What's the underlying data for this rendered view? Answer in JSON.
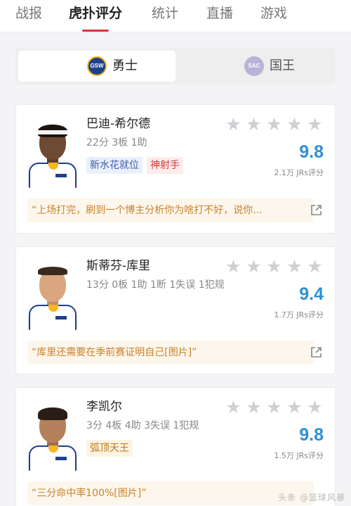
{
  "top_tabs": [
    {
      "label": "战报"
    },
    {
      "label": "虎扑评分"
    },
    {
      "label": "统计"
    },
    {
      "label": "直播"
    },
    {
      "label": "游戏"
    }
  ],
  "team_switch": {
    "home": {
      "logo_text": "GSW",
      "name": "勇士",
      "icon": "warriors-logo-icon"
    },
    "away": {
      "logo_text": "SAC",
      "name": "国王",
      "icon": "kings-logo-icon"
    }
  },
  "colors": {
    "accent_red": "#d33a3a",
    "score_blue": "#2e8fd4",
    "comment_gold": "#c9822c",
    "star_gray": "#cfcfd4"
  },
  "players": [
    {
      "name": "巴迪-希尔德",
      "stats": "22分 3板 1助",
      "tags": [
        {
          "text": "新水花就位",
          "style": "blue"
        },
        {
          "text": "神射手",
          "style": "red"
        }
      ],
      "stars_filled": 0,
      "score": "9.8",
      "raters": "2.1万 JRs评分",
      "comment": "“上场打完，刷到一个博主分析你为啥打不好，说你..."
    },
    {
      "name": "斯蒂芬-库里",
      "stats": "13分 0板 1助 1断 1失误 1犯规",
      "tags": [],
      "stars_filled": 0,
      "score": "9.4",
      "raters": "1.7万 JRs评分",
      "comment": "“库里还需要在季前赛证明自己[图片]”"
    },
    {
      "name": "李凯尔",
      "stats": "3分 4板 4助 3失误 1犯规",
      "tags": [
        {
          "text": "弧顶天王",
          "style": "gold"
        }
      ],
      "stars_filled": 0,
      "score": "9.8",
      "raters": "1.5万 JRs评分",
      "comment": "“三分命中率100%[图片]”"
    }
  ],
  "watermark": "头条 @篮球风暴"
}
